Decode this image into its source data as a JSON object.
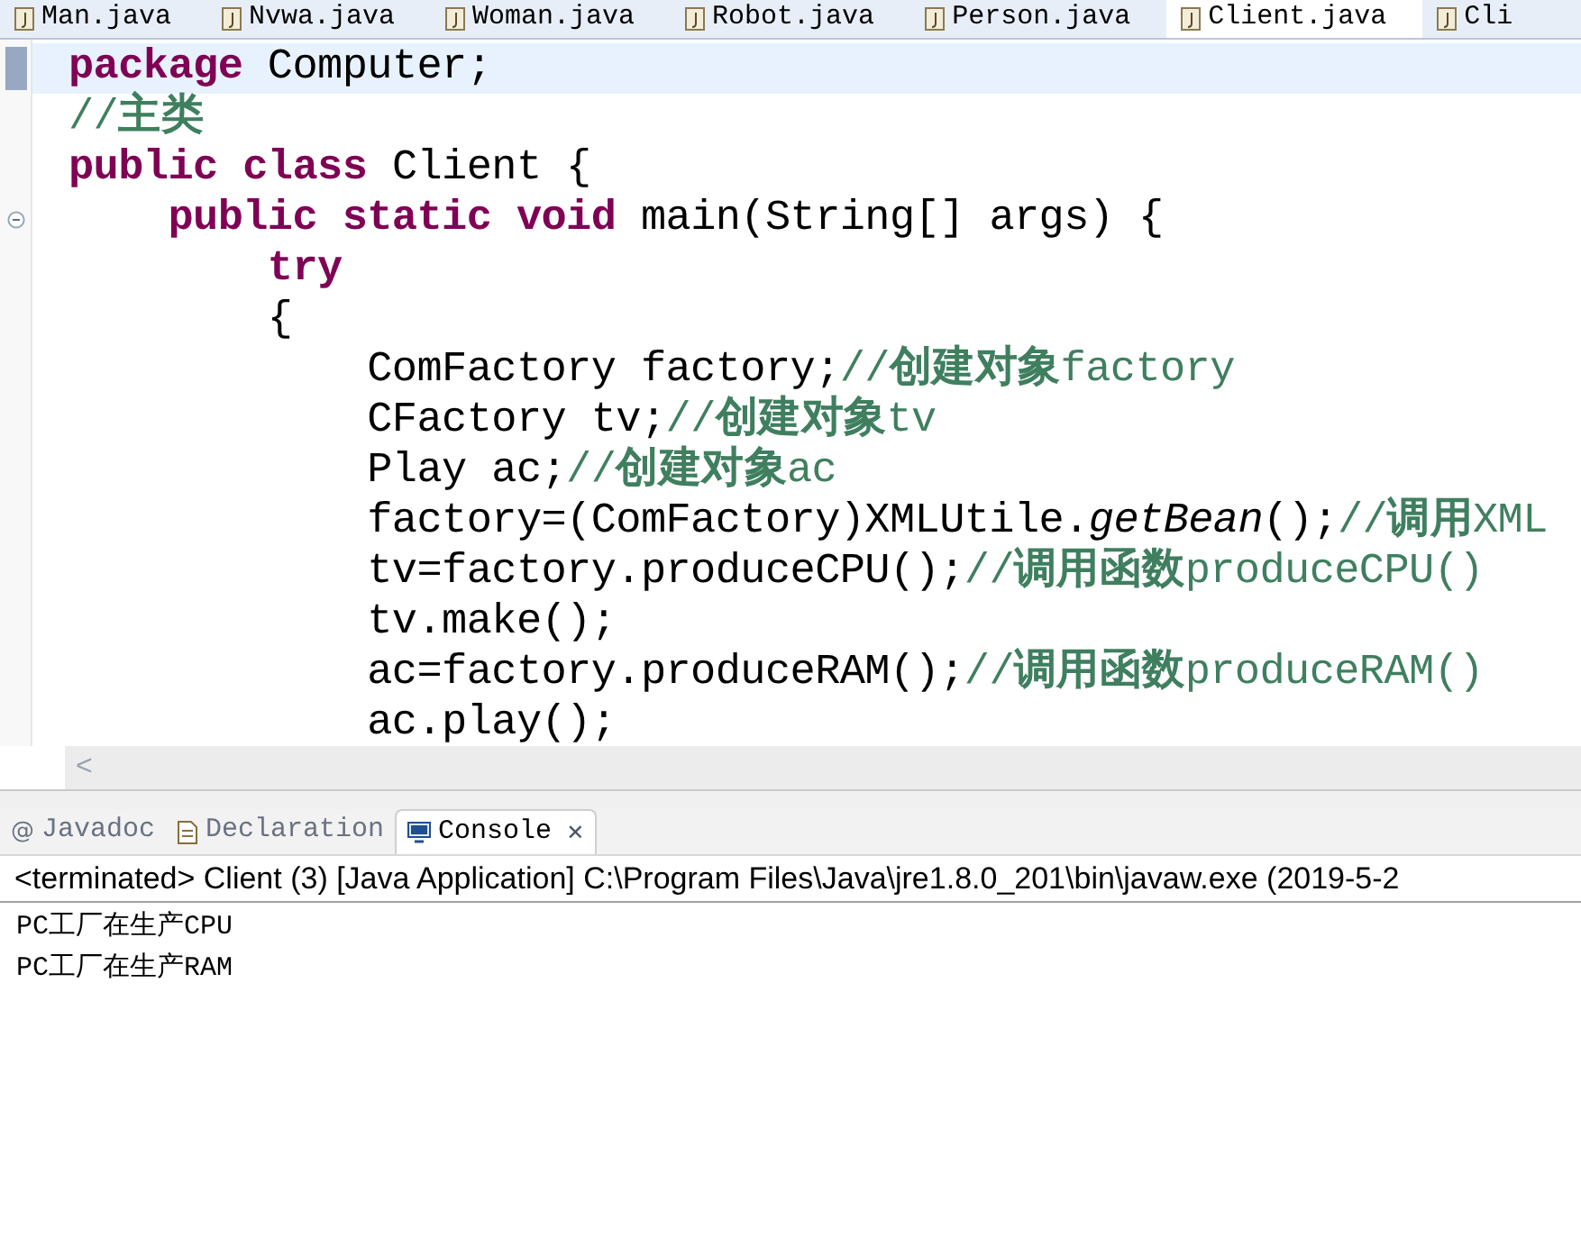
{
  "editor_tabs": [
    {
      "label": "Man.java",
      "selected": false
    },
    {
      "label": "Nvwa.java",
      "selected": false
    },
    {
      "label": "Woman.java",
      "selected": false
    },
    {
      "label": "Robot.java",
      "selected": false
    },
    {
      "label": "Person.java",
      "selected": false
    },
    {
      "label": "Client.java",
      "selected": true
    },
    {
      "label": "Cli",
      "selected": false
    }
  ],
  "code_lines": [
    {
      "current": true,
      "foldable": false,
      "tokens": [
        {
          "kind": "keyword",
          "text": "package"
        },
        {
          "kind": "plain",
          "text": " Computer;"
        }
      ]
    },
    {
      "current": false,
      "foldable": false,
      "tokens": [
        {
          "kind": "comment",
          "text": "//**主类**"
        }
      ]
    },
    {
      "current": false,
      "foldable": false,
      "tokens": [
        {
          "kind": "keyword",
          "text": "public class"
        },
        {
          "kind": "plain",
          "text": " Client {"
        }
      ]
    },
    {
      "current": false,
      "foldable": true,
      "tokens": [
        {
          "kind": "keyword",
          "text": "    public static void"
        },
        {
          "kind": "plain",
          "text": " main(String[] args) {"
        }
      ]
    },
    {
      "current": false,
      "foldable": false,
      "tokens": [
        {
          "kind": "keyword",
          "text": "        try"
        }
      ]
    },
    {
      "current": false,
      "foldable": false,
      "tokens": [
        {
          "kind": "plain",
          "text": "        {"
        }
      ]
    },
    {
      "current": false,
      "foldable": false,
      "tokens": [
        {
          "kind": "plain",
          "text": "            ComFactory factory;"
        },
        {
          "kind": "comment",
          "text": "//**创建对象**factory"
        }
      ]
    },
    {
      "current": false,
      "foldable": false,
      "tokens": [
        {
          "kind": "plain",
          "text": "            CFactory tv;"
        },
        {
          "kind": "comment",
          "text": "//**创建对象**tv"
        }
      ]
    },
    {
      "current": false,
      "foldable": false,
      "tokens": [
        {
          "kind": "plain",
          "text": "            Play ac;"
        },
        {
          "kind": "comment",
          "text": "//**创建对象**ac"
        }
      ]
    },
    {
      "current": false,
      "foldable": false,
      "tokens": [
        {
          "kind": "plain",
          "text": "            factory=(ComFactory)XMLUtile."
        },
        {
          "kind": "italic",
          "text": "getBean"
        },
        {
          "kind": "plain",
          "text": "();"
        },
        {
          "kind": "comment",
          "text": "//**调用**XML"
        }
      ]
    },
    {
      "current": false,
      "foldable": false,
      "tokens": [
        {
          "kind": "plain",
          "text": "            tv=factory.produceCPU();"
        },
        {
          "kind": "comment",
          "text": "//**调用函数**produceCPU()"
        }
      ]
    },
    {
      "current": false,
      "foldable": false,
      "tokens": [
        {
          "kind": "plain",
          "text": "            tv.make();"
        }
      ]
    },
    {
      "current": false,
      "foldable": false,
      "tokens": [
        {
          "kind": "plain",
          "text": "            ac=factory.produceRAM();"
        },
        {
          "kind": "comment",
          "text": "//**调用函数**produceRAM()"
        }
      ]
    },
    {
      "current": false,
      "foldable": false,
      "tokens": [
        {
          "kind": "plain",
          "text": "            ac.play();"
        }
      ]
    }
  ],
  "scroll_left": "<",
  "view_tabs": [
    {
      "label": "Javadoc",
      "glyph": "@",
      "selected": false
    },
    {
      "label": "Declaration",
      "selected": false
    },
    {
      "label": "Console",
      "selected": true,
      "close": "✕"
    }
  ],
  "console": {
    "header": "<terminated> Client (3) [Java Application] C:\\Program Files\\Java\\jre1.8.0_201\\bin\\javaw.exe (2019-5-2",
    "lines": [
      "PC工厂在生产CPU",
      "PC工厂在生产RAM"
    ]
  }
}
